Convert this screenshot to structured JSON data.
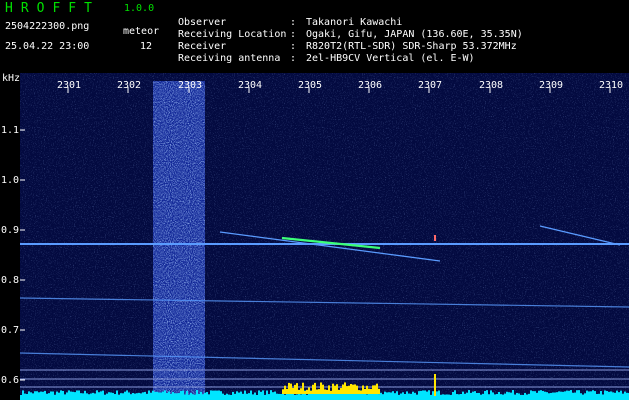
{
  "app": {
    "title": "HROFFT",
    "version": "1.0.0"
  },
  "file_name": "2504222300.png",
  "datetime": "25.04.22 23:00",
  "meteor": {
    "label": "meteor",
    "count": "12"
  },
  "info": [
    {
      "key": "Observer",
      "value": "Takanori Kawachi"
    },
    {
      "key": "Receiving Location",
      "value": "Ogaki, Gifu, JAPAN (136.60E, 35.35N)"
    },
    {
      "key": "Receiver",
      "value": "R820T2(RTL-SDR) SDR-Sharp 53.372MHz"
    },
    {
      "key": "Receiving antenna",
      "value": "2el-HB9CV Vertical (el. E-W)"
    }
  ],
  "axis": {
    "unit": "kHz",
    "time_ticks": [
      "2301",
      "2302",
      "2303",
      "2304",
      "2305",
      "2306",
      "2307",
      "2308",
      "2309",
      "2310"
    ],
    "freq_ticks": [
      "1.1",
      "1.0",
      "0.9",
      "0.8",
      "0.7",
      "0.6"
    ]
  },
  "colors": {
    "background": "#030a40",
    "carrier": "#5a9bff",
    "meteor": "#3cff78",
    "spectrum": "#00e5ff",
    "spectrum_peak": "#ffe600",
    "title": "#00e000"
  }
}
